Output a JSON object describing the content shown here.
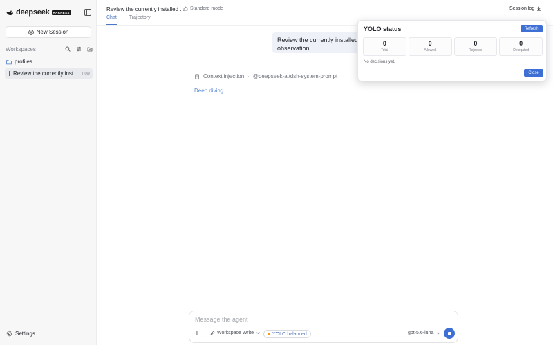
{
  "sidebar": {
    "brand_name": "deepseek",
    "brand_badge": "HARNESS",
    "new_session_label": "New Session",
    "workspaces_title": "Workspaces",
    "folder_label": "profiles",
    "session_title": "Review the currently installed plugins",
    "session_tag": "now",
    "settings_label": "Settings"
  },
  "header": {
    "title": "Review the currently installed ...",
    "mode_label": "Standard mode",
    "session_log_label": "Session log",
    "tabs": [
      {
        "label": "Chat",
        "active": true
      },
      {
        "label": "Trajectory",
        "active": false
      }
    ]
  },
  "chat": {
    "user_message_line1": "Review the currently installed plu",
    "user_message_line2": "observation.",
    "context_label": "Context injection",
    "context_separator": "·",
    "context_value": "@deepseek-ai/dsh-system-prompt",
    "status_text": "Deep diving..."
  },
  "composer": {
    "placeholder": "Message the agent",
    "plus_label": "+",
    "workspace_mode": "Workspace Write",
    "yolo_label": "YOLO balanced",
    "model_label": "gpt-5.6-luna"
  },
  "yolo_panel": {
    "title": "YOLO status",
    "refresh_label": "Refresh",
    "stats": [
      {
        "value": "0",
        "label": "Total"
      },
      {
        "value": "0",
        "label": "Allowed"
      },
      {
        "value": "0",
        "label": "Rejected"
      },
      {
        "value": "0",
        "label": "Delegated"
      }
    ],
    "empty_text": "No decisions yet.",
    "close_label": "Close"
  },
  "colors": {
    "accent": "#3d6fd4",
    "tab_active": "#4b79c7",
    "yolo_dot": "#f59e0b"
  }
}
